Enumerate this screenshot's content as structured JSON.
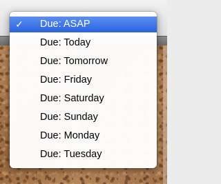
{
  "menu": {
    "check_glyph": "✓",
    "selected_index": 0,
    "items": [
      {
        "label": "Due: ASAP"
      },
      {
        "label": "Due: Today"
      },
      {
        "label": "Due: Tomorrow"
      },
      {
        "label": "Due: Friday"
      },
      {
        "label": "Due: Saturday"
      },
      {
        "label": "Due: Sunday"
      },
      {
        "label": "Due: Monday"
      },
      {
        "label": "Due: Tuesday"
      }
    ]
  },
  "colors": {
    "selection": "#2b63e0",
    "cork": "#b07c4f"
  }
}
